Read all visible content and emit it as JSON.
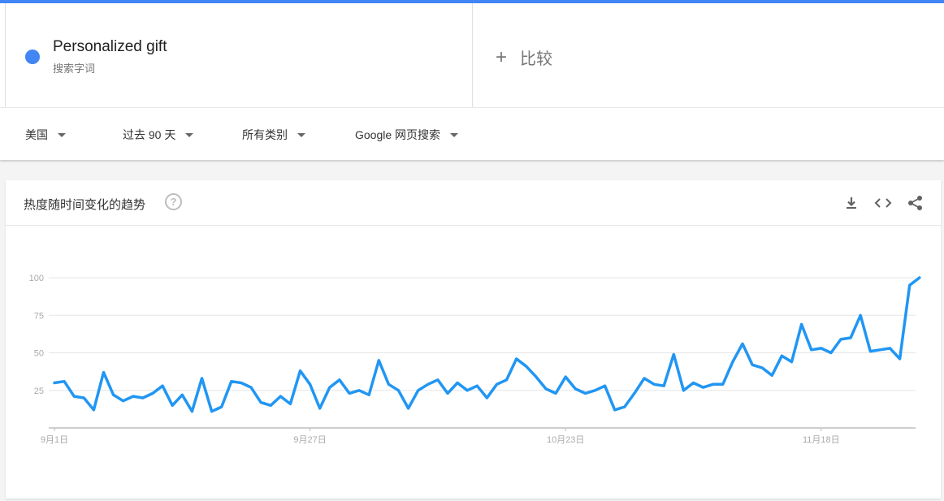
{
  "terms": {
    "term1": {
      "name": "Personalized gift",
      "subtitle": "搜索字词",
      "color": "#4285f4"
    },
    "compare_label": "比较"
  },
  "filters": {
    "region": "美国",
    "time": "过去 90 天",
    "category": "所有类别",
    "property": "Google 网页搜索"
  },
  "card": {
    "title": "热度随时间变化的趋势",
    "help": "?",
    "tools": [
      "download-icon",
      "embed-icon",
      "share-icon"
    ]
  },
  "chart_data": {
    "type": "line",
    "title": "",
    "xlabel": "",
    "ylabel": "",
    "ylim": [
      0,
      100
    ],
    "yticks": [
      25,
      50,
      75,
      100
    ],
    "xtick_labels": [
      {
        "label": "9月1日",
        "index": 0
      },
      {
        "label": "9月27日",
        "index": 26
      },
      {
        "label": "10月23日",
        "index": 52
      },
      {
        "label": "11月18日",
        "index": 78
      }
    ],
    "grid": true,
    "series": [
      {
        "color": "#2196f3",
        "values": [
          30,
          31,
          21,
          20,
          12,
          37,
          22,
          18,
          21,
          20,
          23,
          28,
          15,
          22,
          11,
          33,
          11,
          14,
          31,
          30,
          27,
          17,
          15,
          21,
          16,
          38,
          29,
          13,
          27,
          32,
          23,
          25,
          22,
          45,
          29,
          25,
          13,
          25,
          29,
          32,
          23,
          30,
          25,
          28,
          20,
          29,
          32,
          46,
          41,
          34,
          26,
          23,
          34,
          26,
          23,
          25,
          28,
          12,
          14,
          23,
          33,
          29,
          28,
          49,
          25,
          30,
          27,
          29,
          29,
          44,
          56,
          42,
          40,
          35,
          48,
          44,
          69,
          52,
          53,
          50,
          59,
          60,
          75,
          51,
          52,
          53,
          46,
          95,
          100
        ]
      }
    ]
  }
}
